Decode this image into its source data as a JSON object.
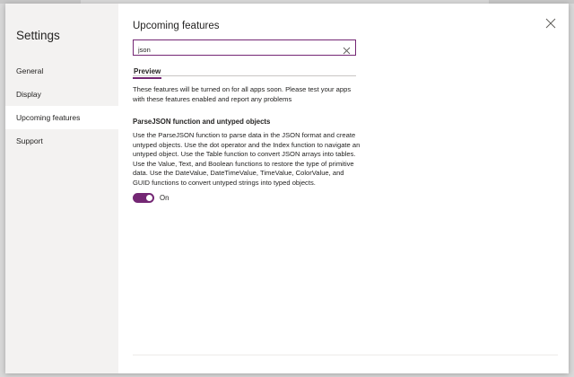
{
  "sidebar": {
    "title": "Settings",
    "items": [
      {
        "label": "General",
        "active": false
      },
      {
        "label": "Display",
        "active": false
      },
      {
        "label": "Upcoming features",
        "active": true
      },
      {
        "label": "Support",
        "active": false
      }
    ]
  },
  "main": {
    "title": "Upcoming features",
    "search": {
      "value": "json",
      "placeholder": ""
    },
    "tabs": [
      {
        "label": "Preview",
        "active": true
      }
    ],
    "intro": "These features will be turned on for all apps soon. Please test your apps with these features enabled and report any problems",
    "feature": {
      "title": "ParseJSON function and untyped objects",
      "description": "Use the ParseJSON function to parse data in the JSON format and create untyped objects. Use the dot operator and the Index function to navigate an untyped object. Use the Table function to convert JSON arrays into tables. Use the Value, Text, and Boolean functions to restore the type of primitive data. Use the DateValue, DateTimeValue, TimeValue, ColorValue, and GUID functions to convert untyped strings into typed objects.",
      "toggle": {
        "state": "On",
        "enabled": true
      }
    }
  },
  "colors": {
    "accent": "#742774",
    "sidebar_bg": "#f3f2f1",
    "text": "#252423"
  },
  "icons": {
    "close": "close-icon",
    "clear": "clear-search-icon"
  }
}
